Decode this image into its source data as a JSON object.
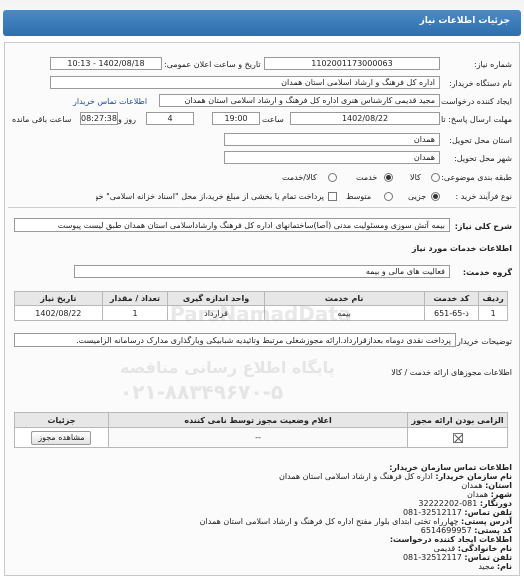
{
  "header": {
    "title": "جزئیات اطلاعات نیاز"
  },
  "form": {
    "need_number_label": "شماره نیاز:",
    "need_number": "1102001173000063",
    "announce_date_label": "تاریخ و ساعت اعلان عمومی:",
    "announce_date": "1402/08/18 - 10:13",
    "buyer_label": "نام دستگاه خریدار:",
    "buyer": "اداره کل فرهنگ و ارشاد اسلامی استان همدان",
    "requester_label": "ایجاد کننده درخواست:",
    "requester": "مجید قدیمی کارشناس هنری اداره کل فرهنگ و ارشاد اسلامی استان همدان",
    "contact_link": "اطلاعات تماس خریدار",
    "deadline_label": "مهلت ارسال پاسخ: تا",
    "deadline_date": "1402/08/22",
    "time_label": "ساعت",
    "deadline_time": "19:00",
    "days": "4",
    "days_label": "روز و",
    "remaining_time": "08:27:38",
    "remaining_label": "ساعت باقی مانده",
    "province_label": "استان محل تحویل:",
    "province": "همدان",
    "city_label": "شهر محل تحویل:",
    "city": "همدان",
    "category_label": "طبقه بندی موضوعی:",
    "category_options": [
      "کالا",
      "خدمت",
      "کالا/خدمت"
    ],
    "process_label": "نوع فرآیند خرید :",
    "process_options": [
      "جزیی",
      "متوسط"
    ],
    "payment_note": "پرداخت تمام یا بخشی از مبلغ خرید،از محل \"اسناد خزانه اسلامی\" خواهد بود."
  },
  "summary": {
    "label": "شرح کلی نیاز:",
    "text": "بیمه آتش سوزی ومسئولیت مدنی (آصا)ساختمانهای اداره کل فرهنگ وارشاداسلامی استان همدان طبق لیست پیوست"
  },
  "services": {
    "section_title": "اطلاعات خدمات مورد نیاز",
    "group_label": "گروه خدمت:",
    "group_value": "فعالیت  های مالی و بیمه",
    "columns": [
      "ردیف",
      "کد خدمت",
      "نام خدمت",
      "واحد اندازه گیری",
      "تعداد / مقدار",
      "تاریخ نیاز"
    ],
    "rows": [
      [
        "1",
        "ذ-65-651",
        "بیمه",
        "قرارداد",
        "1",
        "1402/08/22"
      ]
    ],
    "notes_label": "توضیحات خریدار:",
    "notes": "پرداخت نقدی دوماه بعدازقرارداد.ارائه مجوزشغلی مرتبط وتائیدیه شبابیکی وبارگذاری مدارک درسامانه الزامیست."
  },
  "watermark": {
    "brand": "ParsNamadData",
    "line1": "پایگاه اطلاع رسانی مناقصه",
    "phone": "۰۲۱-۸۸۳۴۹۶۷۰-۵"
  },
  "licenses": {
    "section_title": "اطلاعات مجوزهای ارائه خدمت / کالا",
    "columns": [
      "الزامی بودن ارائه مجوز",
      "اعلام وضعیت مجوز توسط نامی کننده",
      "جزئیات"
    ],
    "status_value": "--",
    "view_button": "مشاهده مجوز"
  },
  "contact": {
    "title": "اطلاعات تماس سازمان خریدار:",
    "org_label": "نام سازمان خریدار:",
    "org": "اداره کل فرهنگ و ارشاد اسلامی استان همدان",
    "province_label": "استان:",
    "province": "همدان",
    "city_label": "شهر:",
    "city": "همدان",
    "fax_label": "دورنگار:",
    "fax": "081-32222202",
    "phone_label": "تلفن تماس:",
    "phone": "32512117-081",
    "address_label": "آدرس پستی:",
    "address": "چهارراه تختی ابتدای بلوار مفتح اداره کل فرهنگ و ارشاد اسلامی استان همدان",
    "postal_label": "کد پستی:",
    "postal": "6514699957",
    "creator_title": "اطلاعات ایجاد کننده درخواست:",
    "family_label": "نام خانوادگی:",
    "family": "قدیمی",
    "creator_phone_label": "تلفن تماس:",
    "creator_phone": "32512117-081",
    "name_label": "نام:",
    "name": "مجید"
  }
}
